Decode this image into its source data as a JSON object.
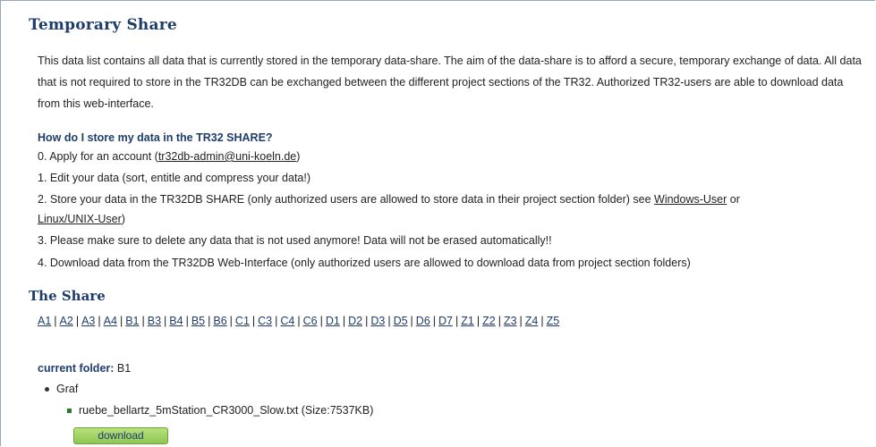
{
  "title": "Temporary Share",
  "intro": "This data list contains all data that is currently stored in the temporary data-share. The aim of the data-share is to afford a secure, temporary exchange of data. All data that is not required to store in the TR32DB can be exchanged between the different project sections of the TR32. Authorized TR32-users are able to download data from this web-interface.",
  "howto": {
    "heading": "How do I store my data in the TR32 SHARE?",
    "step0_prefix": "0. Apply for an account (",
    "step0_link": "tr32db-admin@uni-koeln.de",
    "step0_suffix": ")",
    "step1": "1. Edit your data (sort, entitle and compress your data!)",
    "step2_prefix": "2. Store your data in the TR32DB SHARE (only authorized users are allowed to store data in their project section folder) see ",
    "step2_link1": "Windows-User",
    "step2_or": " or",
    "step2_link2": "Linux/UNIX-User",
    "step2_suffix": ")",
    "step3": "3. Please make sure to delete any data that is not used anymore! Data will not be erased automatically!!",
    "step4": "4. Download data from the TR32DB Web-Interface (only authorized users are allowed to download data from project section folders)"
  },
  "share": {
    "heading": "The Share",
    "folders": [
      "A1",
      "A2",
      "A3",
      "A4",
      "B1",
      "B3",
      "B4",
      "B5",
      "B6",
      "C1",
      "C3",
      "C4",
      "C6",
      "D1",
      "D2",
      "D3",
      "D5",
      "D6",
      "D7",
      "Z1",
      "Z2",
      "Z3",
      "Z4",
      "Z5"
    ],
    "current_label": "current folder:",
    "current_value": "B1",
    "subfolder": "Graf",
    "file": "ruebe_bellartz_5mStation_CR3000_Slow.txt (Size:7537KB)",
    "download_label": "download"
  }
}
